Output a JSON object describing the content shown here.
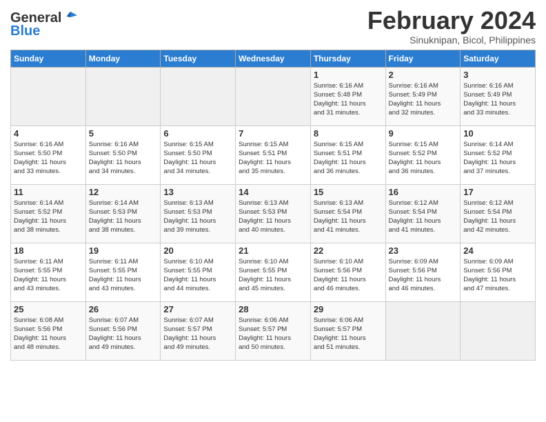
{
  "header": {
    "logo_general": "General",
    "logo_blue": "Blue",
    "title": "February 2024",
    "subtitle": "Sinuknipan, Bicol, Philippines"
  },
  "weekdays": [
    "Sunday",
    "Monday",
    "Tuesday",
    "Wednesday",
    "Thursday",
    "Friday",
    "Saturday"
  ],
  "weeks": [
    [
      {
        "day": "",
        "info": ""
      },
      {
        "day": "",
        "info": ""
      },
      {
        "day": "",
        "info": ""
      },
      {
        "day": "",
        "info": ""
      },
      {
        "day": "1",
        "info": "Sunrise: 6:16 AM\nSunset: 5:48 PM\nDaylight: 11 hours\nand 31 minutes."
      },
      {
        "day": "2",
        "info": "Sunrise: 6:16 AM\nSunset: 5:49 PM\nDaylight: 11 hours\nand 32 minutes."
      },
      {
        "day": "3",
        "info": "Sunrise: 6:16 AM\nSunset: 5:49 PM\nDaylight: 11 hours\nand 33 minutes."
      }
    ],
    [
      {
        "day": "4",
        "info": "Sunrise: 6:16 AM\nSunset: 5:50 PM\nDaylight: 11 hours\nand 33 minutes."
      },
      {
        "day": "5",
        "info": "Sunrise: 6:16 AM\nSunset: 5:50 PM\nDaylight: 11 hours\nand 34 minutes."
      },
      {
        "day": "6",
        "info": "Sunrise: 6:15 AM\nSunset: 5:50 PM\nDaylight: 11 hours\nand 34 minutes."
      },
      {
        "day": "7",
        "info": "Sunrise: 6:15 AM\nSunset: 5:51 PM\nDaylight: 11 hours\nand 35 minutes."
      },
      {
        "day": "8",
        "info": "Sunrise: 6:15 AM\nSunset: 5:51 PM\nDaylight: 11 hours\nand 36 minutes."
      },
      {
        "day": "9",
        "info": "Sunrise: 6:15 AM\nSunset: 5:52 PM\nDaylight: 11 hours\nand 36 minutes."
      },
      {
        "day": "10",
        "info": "Sunrise: 6:14 AM\nSunset: 5:52 PM\nDaylight: 11 hours\nand 37 minutes."
      }
    ],
    [
      {
        "day": "11",
        "info": "Sunrise: 6:14 AM\nSunset: 5:52 PM\nDaylight: 11 hours\nand 38 minutes."
      },
      {
        "day": "12",
        "info": "Sunrise: 6:14 AM\nSunset: 5:53 PM\nDaylight: 11 hours\nand 38 minutes."
      },
      {
        "day": "13",
        "info": "Sunrise: 6:13 AM\nSunset: 5:53 PM\nDaylight: 11 hours\nand 39 minutes."
      },
      {
        "day": "14",
        "info": "Sunrise: 6:13 AM\nSunset: 5:53 PM\nDaylight: 11 hours\nand 40 minutes."
      },
      {
        "day": "15",
        "info": "Sunrise: 6:13 AM\nSunset: 5:54 PM\nDaylight: 11 hours\nand 41 minutes."
      },
      {
        "day": "16",
        "info": "Sunrise: 6:12 AM\nSunset: 5:54 PM\nDaylight: 11 hours\nand 41 minutes."
      },
      {
        "day": "17",
        "info": "Sunrise: 6:12 AM\nSunset: 5:54 PM\nDaylight: 11 hours\nand 42 minutes."
      }
    ],
    [
      {
        "day": "18",
        "info": "Sunrise: 6:11 AM\nSunset: 5:55 PM\nDaylight: 11 hours\nand 43 minutes."
      },
      {
        "day": "19",
        "info": "Sunrise: 6:11 AM\nSunset: 5:55 PM\nDaylight: 11 hours\nand 43 minutes."
      },
      {
        "day": "20",
        "info": "Sunrise: 6:10 AM\nSunset: 5:55 PM\nDaylight: 11 hours\nand 44 minutes."
      },
      {
        "day": "21",
        "info": "Sunrise: 6:10 AM\nSunset: 5:55 PM\nDaylight: 11 hours\nand 45 minutes."
      },
      {
        "day": "22",
        "info": "Sunrise: 6:10 AM\nSunset: 5:56 PM\nDaylight: 11 hours\nand 46 minutes."
      },
      {
        "day": "23",
        "info": "Sunrise: 6:09 AM\nSunset: 5:56 PM\nDaylight: 11 hours\nand 46 minutes."
      },
      {
        "day": "24",
        "info": "Sunrise: 6:09 AM\nSunset: 5:56 PM\nDaylight: 11 hours\nand 47 minutes."
      }
    ],
    [
      {
        "day": "25",
        "info": "Sunrise: 6:08 AM\nSunset: 5:56 PM\nDaylight: 11 hours\nand 48 minutes."
      },
      {
        "day": "26",
        "info": "Sunrise: 6:07 AM\nSunset: 5:56 PM\nDaylight: 11 hours\nand 49 minutes."
      },
      {
        "day": "27",
        "info": "Sunrise: 6:07 AM\nSunset: 5:57 PM\nDaylight: 11 hours\nand 49 minutes."
      },
      {
        "day": "28",
        "info": "Sunrise: 6:06 AM\nSunset: 5:57 PM\nDaylight: 11 hours\nand 50 minutes."
      },
      {
        "day": "29",
        "info": "Sunrise: 6:06 AM\nSunset: 5:57 PM\nDaylight: 11 hours\nand 51 minutes."
      },
      {
        "day": "",
        "info": ""
      },
      {
        "day": "",
        "info": ""
      }
    ]
  ]
}
